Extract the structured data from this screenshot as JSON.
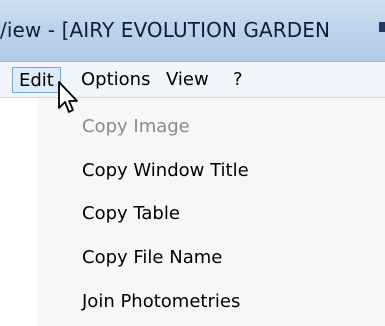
{
  "window": {
    "title": "/iew - [AIRY EVOLUTION GARDEN"
  },
  "menubar": {
    "items": [
      {
        "label": "Edit",
        "active": true
      },
      {
        "label": "Options"
      },
      {
        "label": "View"
      },
      {
        "label": "?"
      }
    ]
  },
  "edit_menu": {
    "items": [
      {
        "label": "Copy Image",
        "enabled": false
      },
      {
        "label": "Copy Window Title",
        "enabled": true
      },
      {
        "label": "Copy Table",
        "enabled": true
      },
      {
        "label": "Copy File Name",
        "enabled": true
      },
      {
        "label": "Join Photometries",
        "enabled": true
      }
    ]
  },
  "cursor": {
    "icon": "arrow-pointer-icon"
  },
  "colors": {
    "titlebar": "#bed3ec",
    "menubar": "#f2f5fb",
    "menu_active_bg": "#dcecfc",
    "menu_active_border": "#7aa6d8",
    "dropdown_bg": "#f7f7f7",
    "disabled_text": "#8a8a8a"
  }
}
